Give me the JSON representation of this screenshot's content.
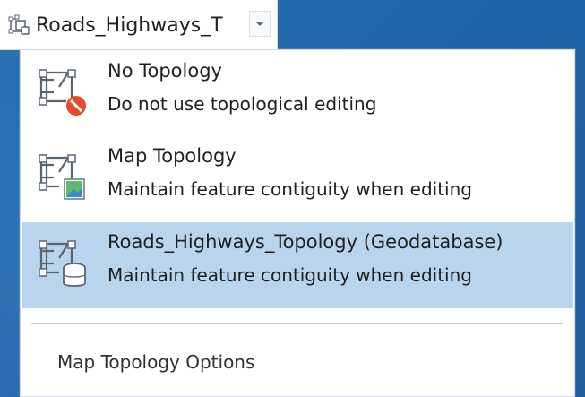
{
  "topology_selector": {
    "selected_label": "Roads_Highways_T",
    "icon": "topology-selector-icon",
    "dropdown_icon": "chevron-down-icon"
  },
  "menu": {
    "items": [
      {
        "title": "No Topology",
        "description": "Do not use topological editing",
        "icon": "no-topology-icon"
      },
      {
        "title": "Map Topology",
        "description": "Maintain feature contiguity when editing",
        "icon": "map-topology-icon"
      },
      {
        "title": "Roads_Highways_Topology (Geodatabase)",
        "description": "Maintain feature contiguity when editing",
        "icon": "geodatabase-topology-icon",
        "selected": true
      }
    ],
    "options_label": "Map Topology Options"
  },
  "colors": {
    "selected_row": "#b9d4ec",
    "menu_border": "#d4d8de",
    "text": "#202020",
    "no_icon": "#e54b2d",
    "map_icon": "#58b86b",
    "database_icon": "#ffffff"
  }
}
